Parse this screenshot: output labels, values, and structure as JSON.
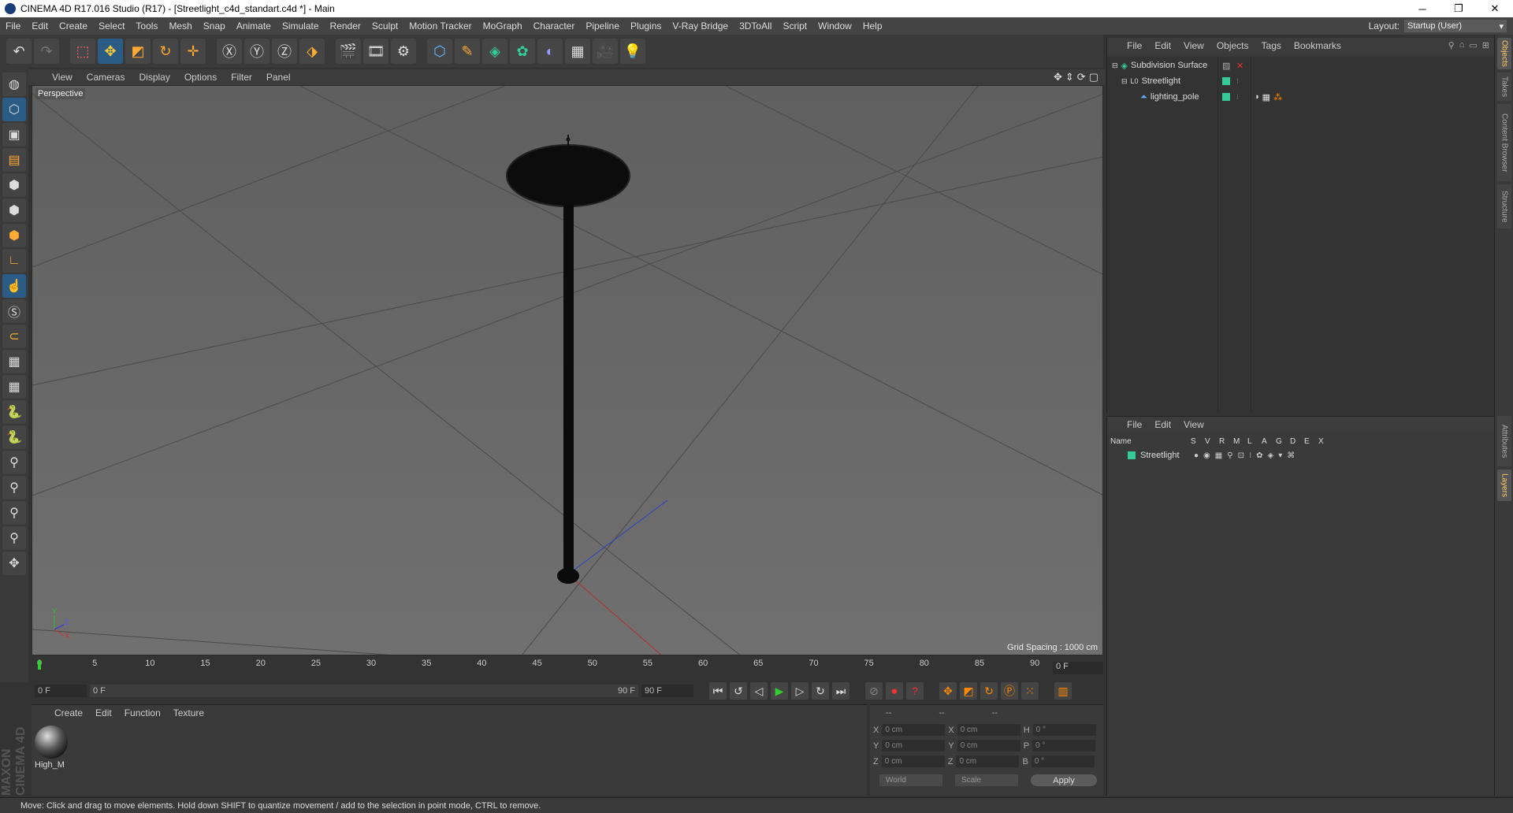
{
  "window": {
    "title": "CINEMA 4D R17.016 Studio (R17) - [Streetlight_c4d_standart.c4d *] - Main",
    "minimize": "─",
    "maximize": "❐",
    "close": "✕"
  },
  "menu": [
    "File",
    "Edit",
    "Create",
    "Select",
    "Tools",
    "Mesh",
    "Snap",
    "Animate",
    "Simulate",
    "Render",
    "Sculpt",
    "Motion Tracker",
    "MoGraph",
    "Character",
    "Pipeline",
    "Plugins",
    "V-Ray Bridge",
    "3DToAll",
    "Script",
    "Window",
    "Help"
  ],
  "layout": {
    "label": "Layout:",
    "value": "Startup (User)"
  },
  "viewport": {
    "menu": [
      "View",
      "Cameras",
      "Display",
      "Options",
      "Filter",
      "Panel"
    ],
    "label": "Perspective",
    "grid_spacing": "Grid Spacing : 1000 cm"
  },
  "timeline": {
    "ticks": [
      "0",
      "5",
      "10",
      "15",
      "20",
      "25",
      "30",
      "35",
      "40",
      "45",
      "50",
      "55",
      "60",
      "65",
      "70",
      "75",
      "80",
      "85",
      "90"
    ],
    "end_frame": "0 F"
  },
  "playback": {
    "current": "0 F",
    "range_start": "0 F",
    "range_end": "90 F",
    "max": "90 F"
  },
  "material_manager": {
    "menu": [
      "Create",
      "Edit",
      "Function",
      "Texture"
    ],
    "material_name": "High_M"
  },
  "coordinates": {
    "header": [
      "--",
      "--",
      "--"
    ],
    "rows": [
      {
        "a": "X",
        "av": "0 cm",
        "b": "X",
        "bv": "0 cm",
        "c": "H",
        "cv": "0 °"
      },
      {
        "a": "Y",
        "av": "0 cm",
        "b": "Y",
        "bv": "0 cm",
        "c": "P",
        "cv": "0 °"
      },
      {
        "a": "Z",
        "av": "0 cm",
        "b": "Z",
        "bv": "0 cm",
        "c": "B",
        "cv": "0 °"
      }
    ],
    "mode1": "World",
    "mode2": "Scale",
    "apply": "Apply"
  },
  "object_manager": {
    "menu": [
      "File",
      "Edit",
      "View",
      "Objects",
      "Tags",
      "Bookmarks"
    ],
    "objects": [
      {
        "name": "Subdivision Surface",
        "indent": 0,
        "icon": "subdivision-icon"
      },
      {
        "name": "Streetlight",
        "indent": 1,
        "icon": "null-icon"
      },
      {
        "name": "lighting_pole",
        "indent": 2,
        "icon": "polygon-icon"
      }
    ]
  },
  "layer_manager": {
    "menu": [
      "File",
      "Edit",
      "View"
    ],
    "columns": [
      "Name",
      "S",
      "V",
      "R",
      "M",
      "L",
      "A",
      "G",
      "D",
      "E",
      "X"
    ],
    "layers": [
      {
        "name": "Streetlight",
        "color": "#33cc99"
      }
    ]
  },
  "side_tabs": [
    "Objects",
    "Takes",
    "Content Browser",
    "Structure",
    "Attributes",
    "Layers"
  ],
  "brand": "MAXON CINEMA 4D",
  "status": "Move: Click and drag to move elements. Hold down SHIFT to quantize movement / add to the selection in point mode, CTRL to remove."
}
